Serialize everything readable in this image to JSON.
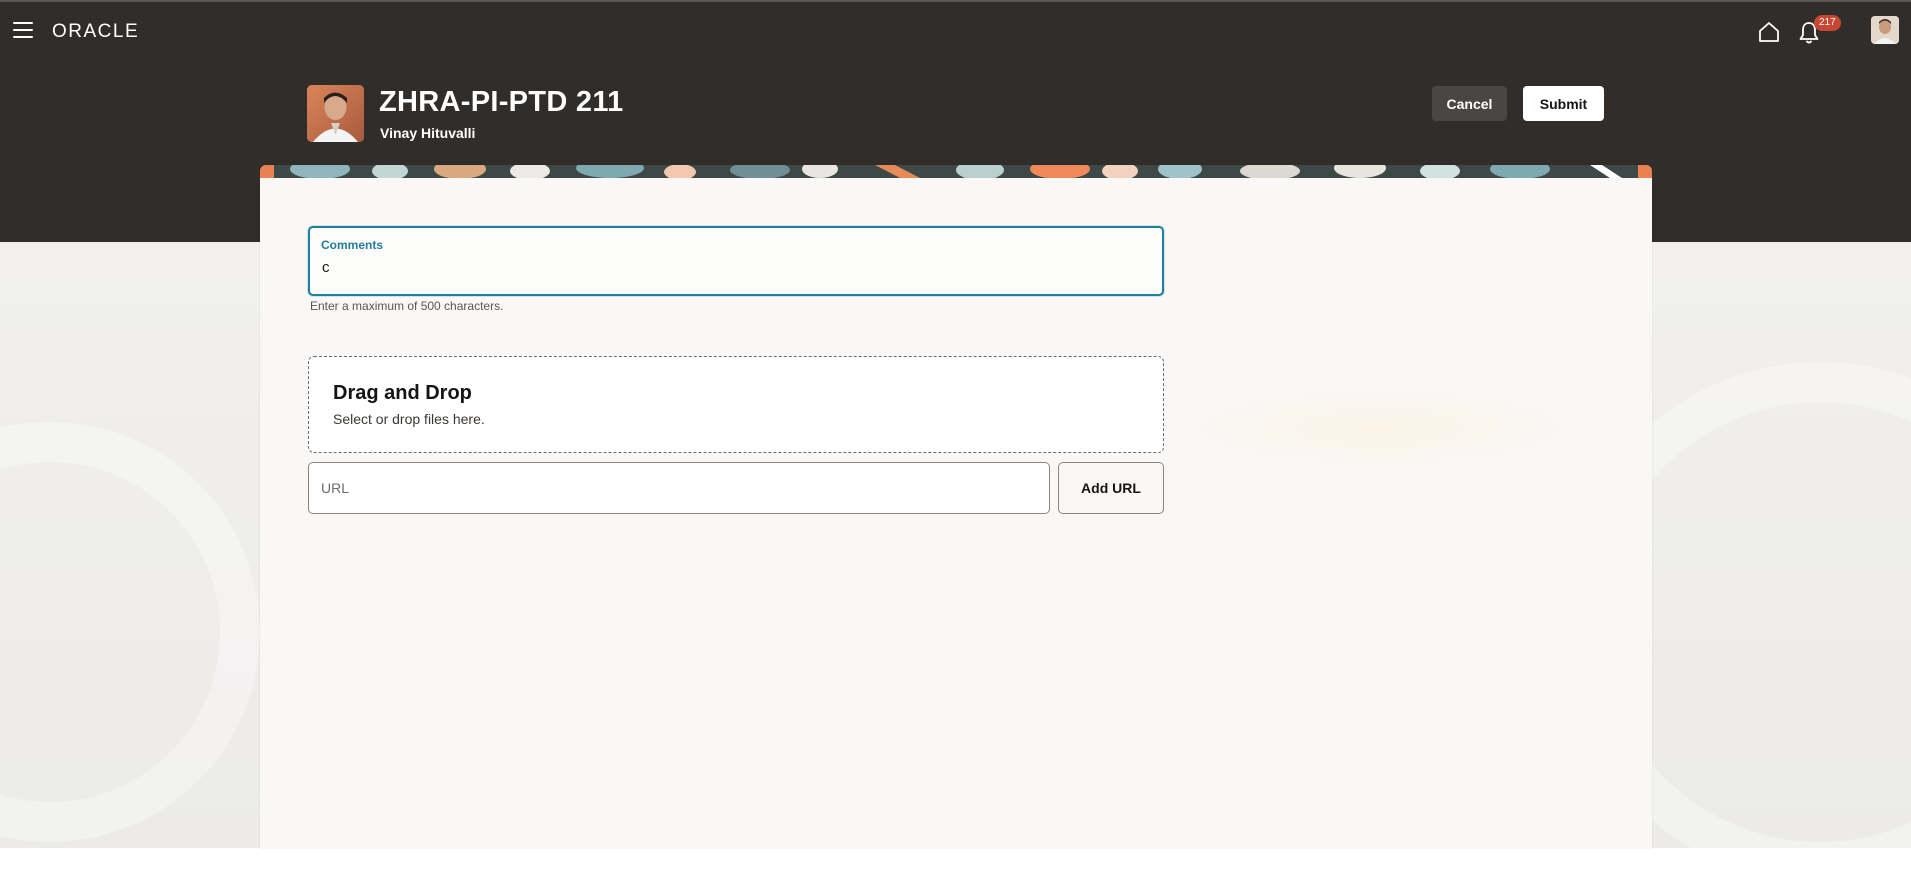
{
  "header": {
    "logo_text": "ORACLE",
    "notification_count": "217",
    "title": "ZHRA-PI-PTD 211",
    "subtitle": "Vinay Hituvalli",
    "cancel_label": "Cancel",
    "submit_label": "Submit"
  },
  "form": {
    "comments": {
      "label": "Comments",
      "value": "c",
      "help": "Enter a maximum of 500 characters."
    },
    "dropzone": {
      "title": "Drag and Drop",
      "subtitle": "Select or drop files here."
    },
    "url": {
      "placeholder": "URL",
      "add_label": "Add URL"
    }
  },
  "colors": {
    "header_bg": "#312d2a",
    "focus_border": "#227e9e",
    "badge": "#c74634",
    "panel_bg": "#f9f8f6"
  },
  "icons": [
    "hamburger-menu-icon",
    "home-icon",
    "bell-icon",
    "user-avatar"
  ]
}
